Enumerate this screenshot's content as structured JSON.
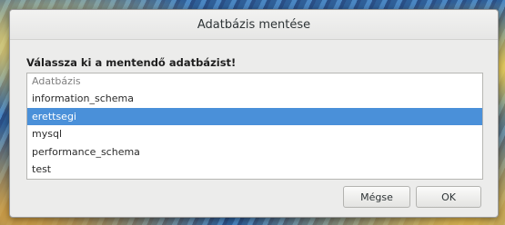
{
  "dialog": {
    "title": "Adatbázis mentése",
    "prompt": "Válassza ki a mentendő adatbázist!"
  },
  "list": {
    "header": "Adatbázis",
    "items": [
      {
        "label": "information_schema",
        "selected": false
      },
      {
        "label": "erettsegi",
        "selected": true
      },
      {
        "label": "mysql",
        "selected": false
      },
      {
        "label": "performance_schema",
        "selected": false
      },
      {
        "label": "test",
        "selected": false
      }
    ]
  },
  "buttons": {
    "cancel_label": "Mégse",
    "ok_label": "OK"
  },
  "colors": {
    "selection": "#4a90d9",
    "dialog_bg": "#ececeb"
  }
}
